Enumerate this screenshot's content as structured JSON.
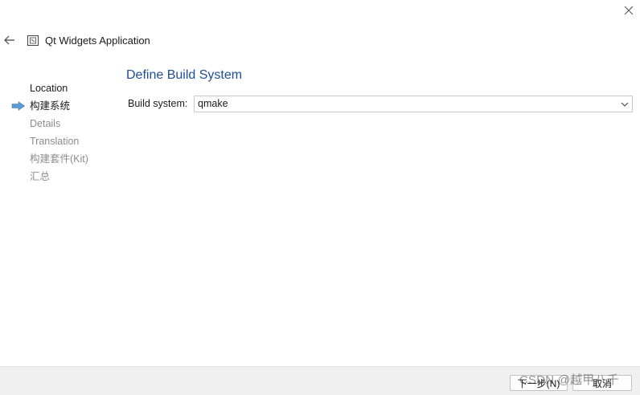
{
  "window": {
    "title": "Qt Widgets Application",
    "close_icon": "close-icon",
    "back_icon": "back-arrow-icon",
    "app_icon": "qt-app-icon"
  },
  "steps": [
    {
      "label": "Location",
      "state": "done"
    },
    {
      "label": "构建系统",
      "state": "current"
    },
    {
      "label": "Details",
      "state": "pending"
    },
    {
      "label": "Translation",
      "state": "pending"
    },
    {
      "label": "构建套件(Kit)",
      "state": "pending"
    },
    {
      "label": "汇总",
      "state": "pending"
    }
  ],
  "page": {
    "title": "Define Build System",
    "build_system_label": "Build system:",
    "build_system_value": "qmake"
  },
  "footer": {
    "next_label": "下一步(N)",
    "cancel_label": "取消"
  },
  "watermark": "CSDN @越甲八千",
  "colors": {
    "accent_title": "#1f4e96",
    "current_arrow": "#5b9bd5",
    "pending_text": "#8c8c8c"
  }
}
